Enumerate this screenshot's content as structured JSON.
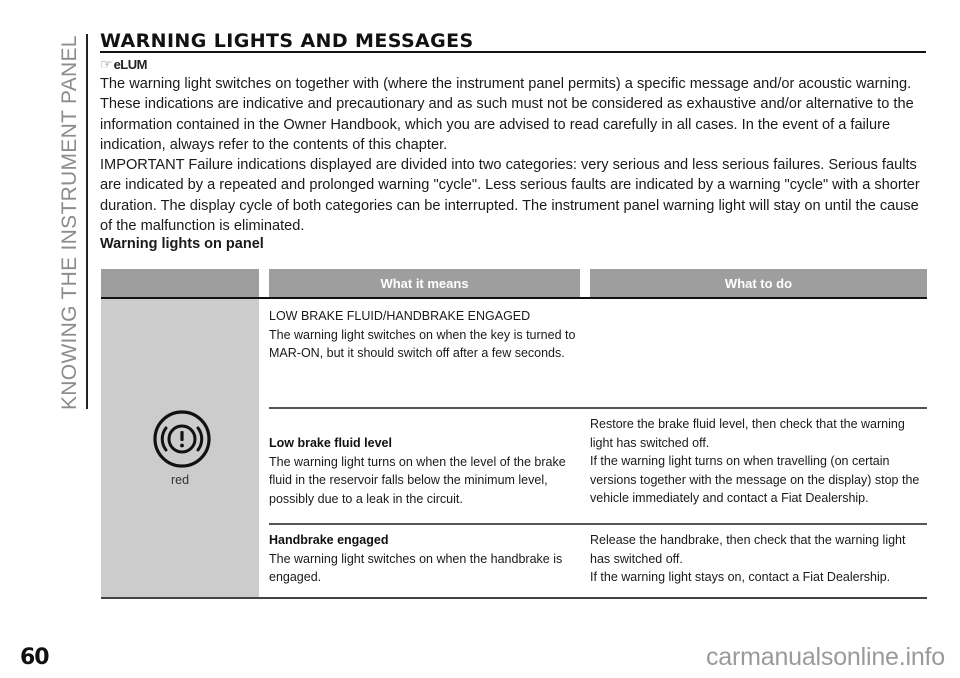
{
  "page": {
    "side_title": "KNOWING THE INSTRUMENT PANEL",
    "section_title": "WARNING LIGHTS AND MESSAGES",
    "language_marker": {
      "icon": "pointing-hand-icon",
      "code": "eLUM"
    },
    "intro_paragraphs": [
      "The warning light switches on together with (where the instrument panel permits) a specific message and/or acoustic warning. These indications are indicative and precautionary and as such must not be considered as exhaustive and/or alternative to the information contained in the Owner Handbook, which you are advised to read carefully in all cases. In the event of a failure indication, always refer to the contents of this chapter.",
      "IMPORTANT Failure indications displayed are divided into two categories: very serious and less serious failures. Serious faults are indicated by a repeated and prolonged warning \"cycle\". Less serious faults are indicated by a warning \"cycle\" with a shorter duration. The display cycle of both categories can be interrupted. The instrument panel warning light will stay on until the cause of the malfunction is eliminated."
    ],
    "subheading": "Warning lights on panel",
    "page_number": "60",
    "watermark": "carmanualsonline.info"
  },
  "table": {
    "columns": [
      "",
      "What it means",
      "What to do"
    ],
    "warning_light": {
      "icon": "brake-warning-icon",
      "color_label": "red",
      "color": "#d32f2f"
    },
    "rows": [
      {
        "title": "",
        "means_heading": "LOW BRAKE FLUID/HANDBRAKE ENGAGED",
        "means": "The warning light switches on when the key is turned to MAR-ON, but it should switch off after a few seconds.",
        "todo": ""
      },
      {
        "title": "Low brake fluid level",
        "means": "The warning light turns on when the level of the brake fluid in the reservoir falls below the minimum level, possibly due to a leak in the circuit.",
        "todo": "Restore the brake fluid level, then check that the warning light has switched off.",
        "todo_2": "If the warning light turns on when travelling (on certain versions together with the message on the display) stop the vehicle immediately and contact a Fiat Dealership."
      },
      {
        "title": "Handbrake engaged",
        "means": "The warning light switches on when the handbrake is engaged.",
        "todo": "Release the handbrake, then check that the warning light has switched off.",
        "todo_2": "If the warning light stays on, contact a Fiat Dealership."
      }
    ]
  }
}
